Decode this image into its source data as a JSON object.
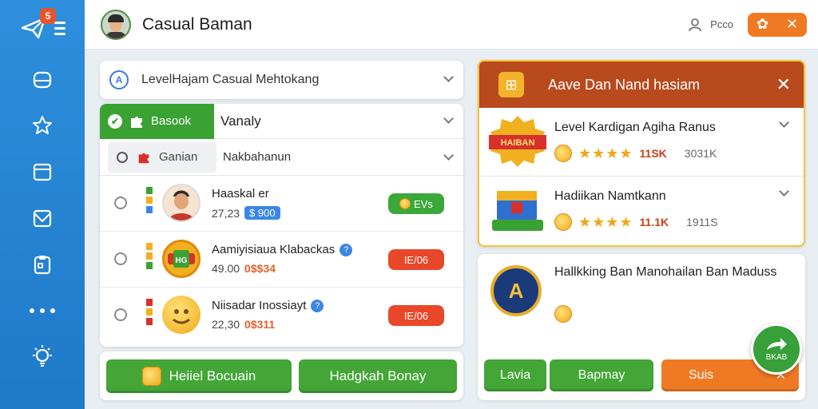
{
  "header": {
    "title": "Casual Baman",
    "user_label": "Pcco",
    "action_symbols": [
      "✿",
      "✕"
    ]
  },
  "sidebar": {
    "badge": "5",
    "items": [
      "home",
      "star",
      "calendar",
      "inbox",
      "clipboard",
      "more",
      "settings"
    ]
  },
  "search": {
    "icon_letter": "A",
    "value": "LevelHajam Casual Mehtokang"
  },
  "filters": {
    "primary_tag": "Basook",
    "primary_label": "Vanaly",
    "secondary_tag": "Ganian",
    "secondary_label": "Nakbahanun"
  },
  "items": [
    {
      "title": "Haaskal er",
      "amount": "27,23",
      "price": "$ 900",
      "button": "EVs",
      "button_color": "#3ba83a",
      "thumb": "person"
    },
    {
      "title": "Aamiyisiaua Klabackas",
      "amount": "49.00",
      "price": "0$$34",
      "button": "IE/06",
      "button_color": "#e8472a",
      "thumb": "badge",
      "info": "?"
    },
    {
      "title": "Niisadar Inossiayt",
      "amount": "22,30",
      "price": "0$311",
      "button": "IE/06",
      "button_color": "#e8472a",
      "thumb": "emoji",
      "info": "?"
    }
  ],
  "bottom_buttons": [
    "Heiiel Bocuain",
    "Hadgkah Bonay"
  ],
  "right_panel": {
    "header_title": "Aave Dan Nand hasiam",
    "bonuses": [
      {
        "title": "Level Kardigan Agiha Ranus",
        "stars": 4,
        "value": "11SK",
        "value2": "3031K",
        "badge_text": "HAIBAN"
      },
      {
        "title": "Hadiikan Namtkann",
        "stars": 4,
        "value": "11.1K",
        "value2": "1911S"
      }
    ]
  },
  "bottom_right": {
    "title": "Hallkking Ban Manohailan Ban Maduss",
    "medal_letter": "A",
    "buttons": [
      {
        "label": "Lavia",
        "color": "#43a636"
      },
      {
        "label": "Bapmay",
        "color": "#43a636"
      },
      {
        "label": "Suis",
        "color": "#f07a24",
        "symbol": "✕"
      }
    ],
    "fab_label": "BKAB"
  },
  "colors": {
    "sidebar": "#2487d6",
    "accent_green": "#3aa232",
    "accent_orange": "#f07a24",
    "header_brown": "#b84a1e"
  }
}
